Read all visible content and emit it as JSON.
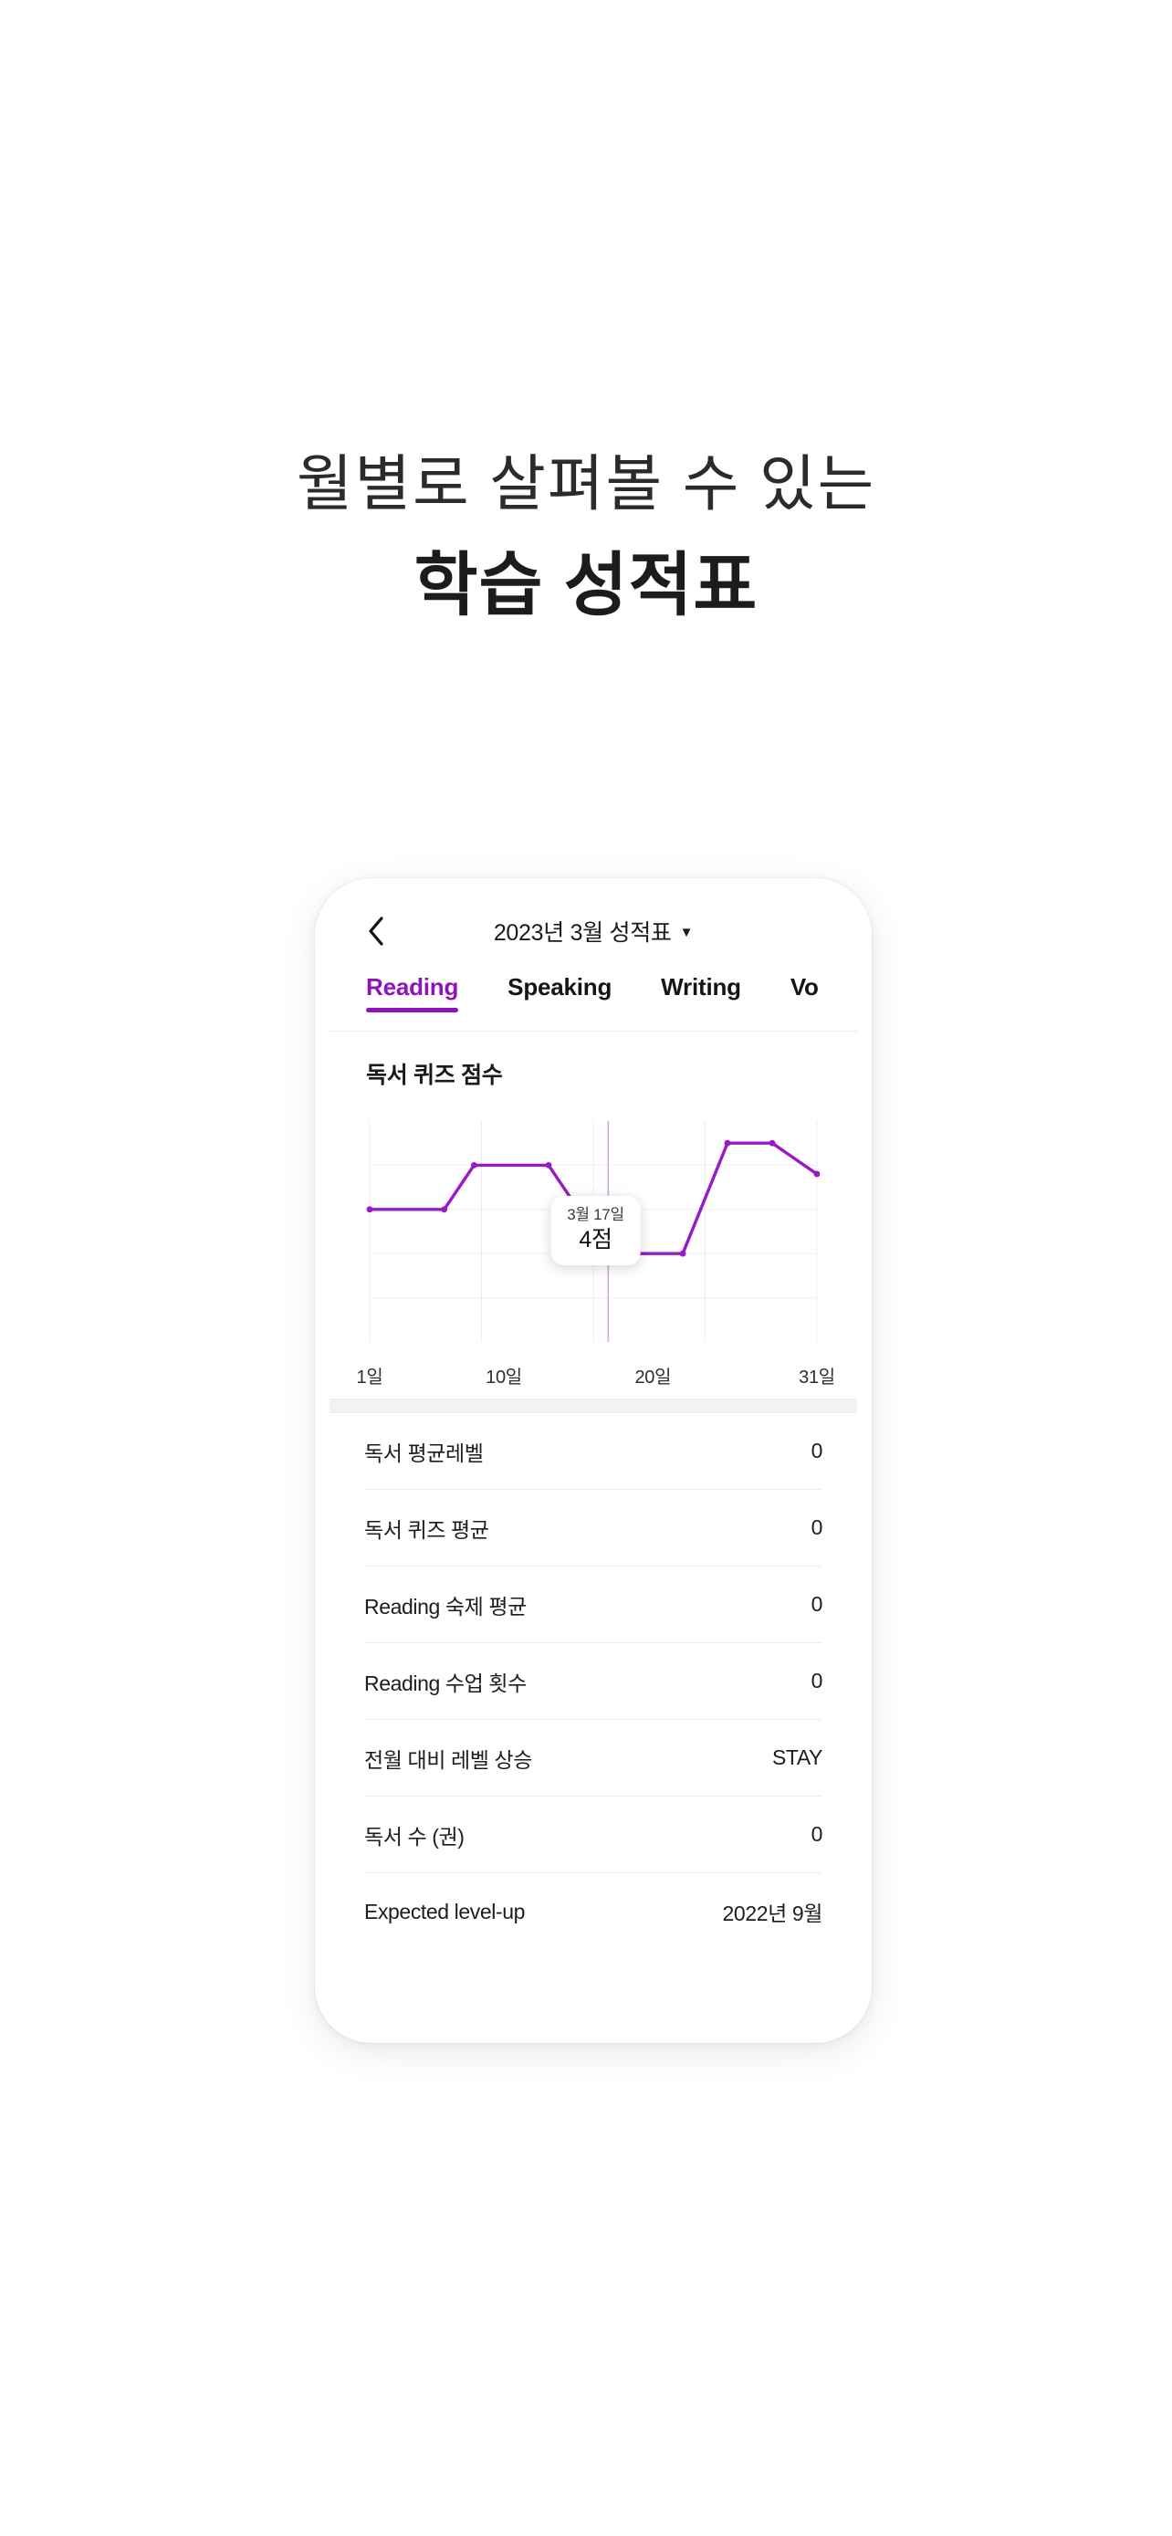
{
  "headline": {
    "line1": "월별로 살펴볼 수 있는",
    "line2": "학습 성적표"
  },
  "colors": {
    "accent": "#8f12bd",
    "text": "#1b1b1b",
    "muted": "#6e6e6e",
    "divider": "#eeeeee",
    "section_gap": "#f2f2f2"
  },
  "phone": {
    "navbar": {
      "back_label": "‹",
      "title": "2023년 3월 성적표",
      "caret": "▼"
    },
    "tabs": [
      {
        "label": "Reading",
        "active": true
      },
      {
        "label": "Speaking",
        "active": false
      },
      {
        "label": "Writing",
        "active": false
      },
      {
        "label": "Vo",
        "active": false
      }
    ],
    "chart_section": {
      "title": "독서 퀴즈 점수",
      "tooltip": {
        "date": "3월 17일",
        "value": "4점"
      }
    },
    "stats": {
      "rows": [
        {
          "label": "독서 평균레벨",
          "value": "0"
        },
        {
          "label": "독서 퀴즈 평균",
          "value": "0"
        },
        {
          "label": "Reading 숙제 평균",
          "value": "0"
        },
        {
          "label": "Reading 수업 횟수",
          "value": "0"
        },
        {
          "label": "전월 대비 레벨 상승",
          "value": "STAY"
        },
        {
          "label": "독서 수 (권)",
          "value": "0"
        },
        {
          "label": "Expected level-up",
          "value": "2022년 9월"
        }
      ]
    }
  },
  "chart_data": {
    "type": "line",
    "title": "독서 퀴즈 점수",
    "xlabel": "",
    "ylabel": "",
    "grid": true,
    "legend": false,
    "xtick_labels": [
      "1일",
      "10일",
      "20일",
      "31일"
    ],
    "xtick_days": [
      1,
      10,
      20,
      31
    ],
    "xlim": [
      1,
      31
    ],
    "ylim": [
      0,
      10
    ],
    "gridlines_y": [
      2,
      4,
      6,
      8
    ],
    "gridlines_x": [
      1,
      8.5,
      16,
      23.5,
      31
    ],
    "highlight_x": 17,
    "series": [
      {
        "name": "독서 퀴즈 점수",
        "color": "#9a18c6",
        "x": [
          1,
          6,
          8,
          13,
          17,
          19,
          22,
          25,
          28,
          31
        ],
        "values": [
          6,
          6,
          8,
          8,
          4,
          4,
          4,
          9,
          9,
          7.6
        ]
      }
    ],
    "annotations": [
      {
        "x": 17,
        "y": 4,
        "date": "3월 17일",
        "text": "4점",
        "marker": "hollow-circle"
      }
    ]
  }
}
